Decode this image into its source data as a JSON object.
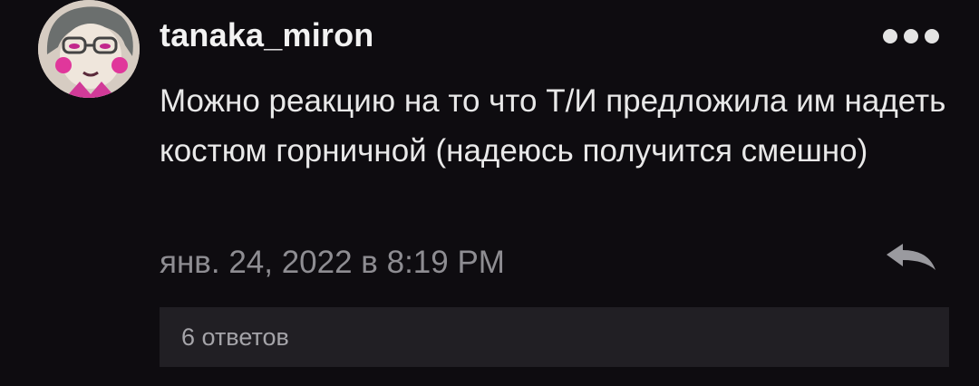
{
  "comment": {
    "username": "tanaka_miron",
    "text": "Можно реакцию на то что Т/И предложила им надеть костюм горничной (надеюсь получится смешно)",
    "timestamp": "янв. 24, 2022 в 8:19 PM",
    "replies_label": "6 ответов"
  },
  "icons": {
    "avatar": "cartoon-avatar",
    "more": "more-dots-icon",
    "reply": "reply-arrow-icon"
  },
  "colors": {
    "background": "#0e0c10",
    "text": "#e9e9e9",
    "muted": "#8e8d92",
    "replies_bar": "#211f24"
  }
}
